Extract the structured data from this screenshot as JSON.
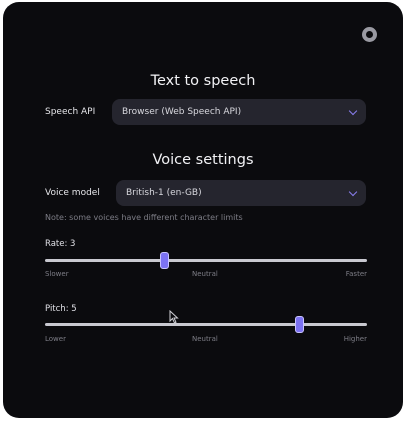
{
  "tts": {
    "heading": "Text to speech",
    "api_label": "Speech API",
    "api_value": "Browser (Web Speech API)"
  },
  "voice": {
    "heading": "Voice settings",
    "model_label": "Voice model",
    "model_value": "British-1 (en-GB)",
    "note": "Note: some voices have different character limits"
  },
  "rate": {
    "label": "Rate: 3",
    "value_fraction": 0.37,
    "min_label": "Slower",
    "mid_label": "Neutral",
    "max_label": "Faster"
  },
  "pitch": {
    "label": "Pitch: 5",
    "value_fraction": 0.79,
    "min_label": "Lower",
    "mid_label": "Neutral",
    "max_label": "Higher"
  },
  "colors": {
    "panel_bg": "#0b0b0e",
    "accent": "#7c72f2"
  },
  "icons": {
    "close": "close-icon",
    "chevron": "chevron-down-icon",
    "cursor": "mouse-pointer-icon"
  }
}
